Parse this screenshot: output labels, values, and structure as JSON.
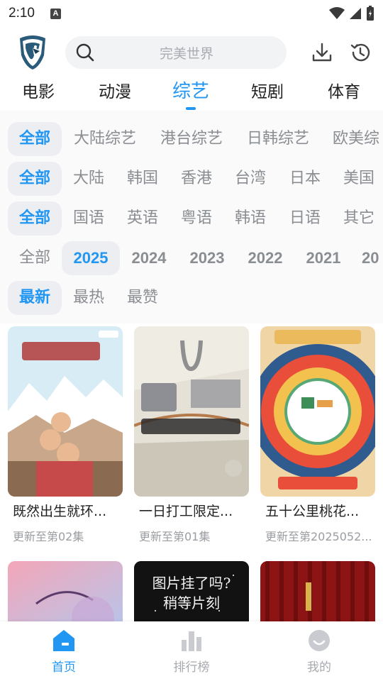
{
  "status_bar": {
    "time": "2:10",
    "notif_letter": "A"
  },
  "header": {
    "search_placeholder": "完美世界",
    "logo_icon": "eagle-logo",
    "download_icon": "download-icon",
    "history_icon": "history-icon"
  },
  "categories": [
    "电影",
    "动漫",
    "综艺",
    "短剧",
    "体育"
  ],
  "active_category": "综艺",
  "filters": {
    "type": [
      "全部",
      "大陆综艺",
      "港台综艺",
      "日韩综艺",
      "欧美综"
    ],
    "region": [
      "全部",
      "大陆",
      "韩国",
      "香港",
      "台湾",
      "日本",
      "美国"
    ],
    "language": [
      "全部",
      "国语",
      "英语",
      "粤语",
      "韩语",
      "日语",
      "其它"
    ],
    "year": [
      "全部",
      "2025",
      "2024",
      "2023",
      "2022",
      "2021",
      "20"
    ],
    "sort": [
      "最新",
      "最热",
      "最赞"
    ]
  },
  "cards": [
    {
      "title": "既然出生就环...",
      "subtitle": "更新至第02集"
    },
    {
      "title": "一日打工限定...",
      "subtitle": "更新至第01集"
    },
    {
      "title": "五十公里桃花...",
      "subtitle": "更新至第2025052..."
    },
    {
      "title": "",
      "subtitle": ""
    },
    {
      "title": "",
      "subtitle": "",
      "poster_text": "图片挂了吗？\n稍等片刻",
      "poster_line1": "图片挂了吗?",
      "poster_line2": "稍等片刻"
    },
    {
      "title": "",
      "subtitle": ""
    }
  ],
  "bottom_nav": [
    {
      "label": "首页",
      "icon": "home-icon"
    },
    {
      "label": "排行榜",
      "icon": "ranking-icon"
    },
    {
      "label": "我的",
      "icon": "profile-icon"
    }
  ],
  "colors": {
    "accent": "#2196f3",
    "chip_bg": "#eceef1",
    "muted": "#8a8d92"
  }
}
